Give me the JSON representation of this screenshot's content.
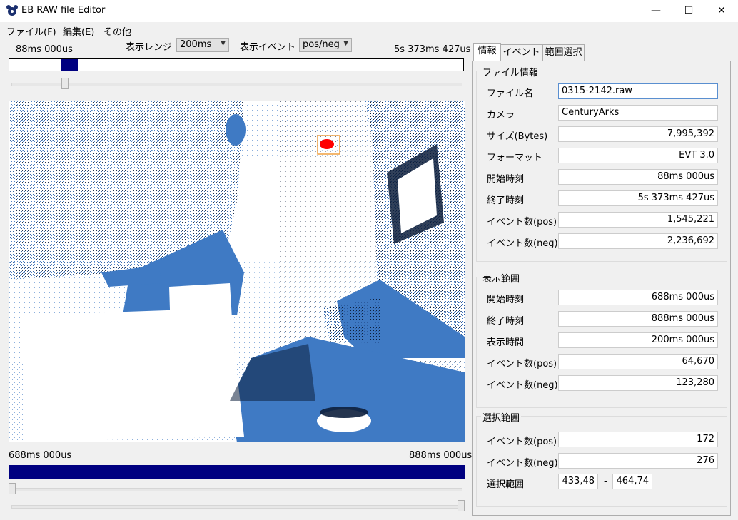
{
  "window": {
    "title": "EB RAW file Editor",
    "minimize_glyph": "—",
    "maximize_glyph": "☐",
    "close_glyph": "✕"
  },
  "menu": [
    "ファイル(F)",
    "編集(E)",
    "その他"
  ],
  "toolbar": {
    "file_start": "88ms 000us",
    "range_label": "表示レンジ",
    "range_value": "200ms",
    "event_label": "表示イベント",
    "event_value": "pos/neg",
    "file_end": "5s 373ms 427us"
  },
  "timeline": {
    "view_start": "688ms 000us",
    "view_end": "888ms 000us",
    "window_color": "#000080"
  },
  "tabs": [
    "情報",
    "イベント",
    "範囲選択"
  ],
  "file_info": {
    "title": "ファイル情報",
    "rows": [
      {
        "label": "ファイル名",
        "value": "0315-2142.raw"
      },
      {
        "label": "カメラ",
        "value": "CenturyArks"
      },
      {
        "label": "サイズ(Bytes)",
        "value": "7,995,392"
      },
      {
        "label": "フォーマット",
        "value": "EVT 3.0"
      },
      {
        "label": "開始時刻",
        "value": "88ms 000us"
      },
      {
        "label": "終了時刻",
        "value": "5s 373ms 427us"
      },
      {
        "label": "イベント数(pos)",
        "value": "1,545,221"
      },
      {
        "label": "イベント数(neg)",
        "value": "2,236,692"
      }
    ]
  },
  "display_range": {
    "title": "表示範囲",
    "rows": [
      {
        "label": "開始時刻",
        "value": "688ms 000us"
      },
      {
        "label": "終了時刻",
        "value": "888ms 000us"
      },
      {
        "label": "表示時間",
        "value": "200ms 000us"
      },
      {
        "label": "イベント数(pos)",
        "value": "64,670"
      },
      {
        "label": "イベント数(neg)",
        "value": "123,280"
      }
    ]
  },
  "selection": {
    "title": "選択範囲",
    "rows": [
      {
        "label": "イベント数(pos)",
        "value": "172"
      },
      {
        "label": "イベント数(neg)",
        "value": "276"
      }
    ],
    "range_label": "選択範囲",
    "range_from": "433,48",
    "range_sep": "-",
    "range_to": "464,74"
  },
  "colors": {
    "pos_event": "#3f7ac4",
    "neg_event": "#0d1f3c",
    "selection_box": "#f0a040",
    "selected_events": "#ff0000"
  }
}
